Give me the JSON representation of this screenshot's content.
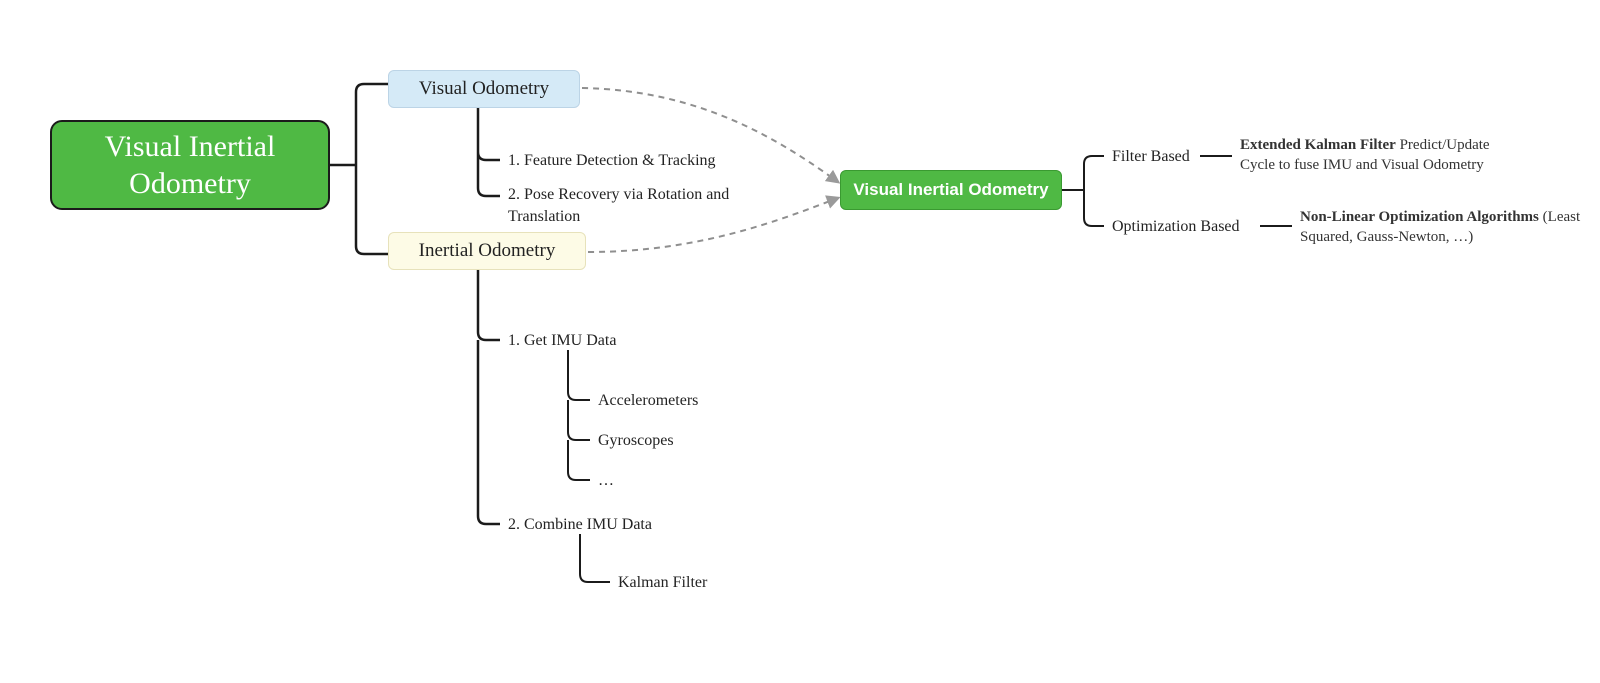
{
  "root": {
    "title": "Visual Inertial Odometry"
  },
  "visual": {
    "title": "Visual Odometry",
    "steps": [
      "1. Feature Detection & Tracking",
      "2. Pose Recovery via Rotation and Translation"
    ]
  },
  "inertial": {
    "title": "Inertial Odometry",
    "step1": "1. Get IMU Data",
    "imu_sources": [
      "Accelerometers",
      "Gyroscopes",
      "…"
    ],
    "step2": "2. Combine IMU Data",
    "combine_methods": [
      "Kalman Filter"
    ]
  },
  "fusion": {
    "title": "Visual Inertial Odometry",
    "branches": [
      {
        "name": "Filter Based",
        "detail_bold": "Extended Kalman Filter",
        "detail_rest": " Predict/Update Cycle to fuse IMU and Visual Odometry"
      },
      {
        "name": "Optimization Based",
        "detail_bold": "Non-Linear Optimization Algorithms",
        "detail_rest": " (Least Squared, Gauss-Newton, …)"
      }
    ]
  }
}
